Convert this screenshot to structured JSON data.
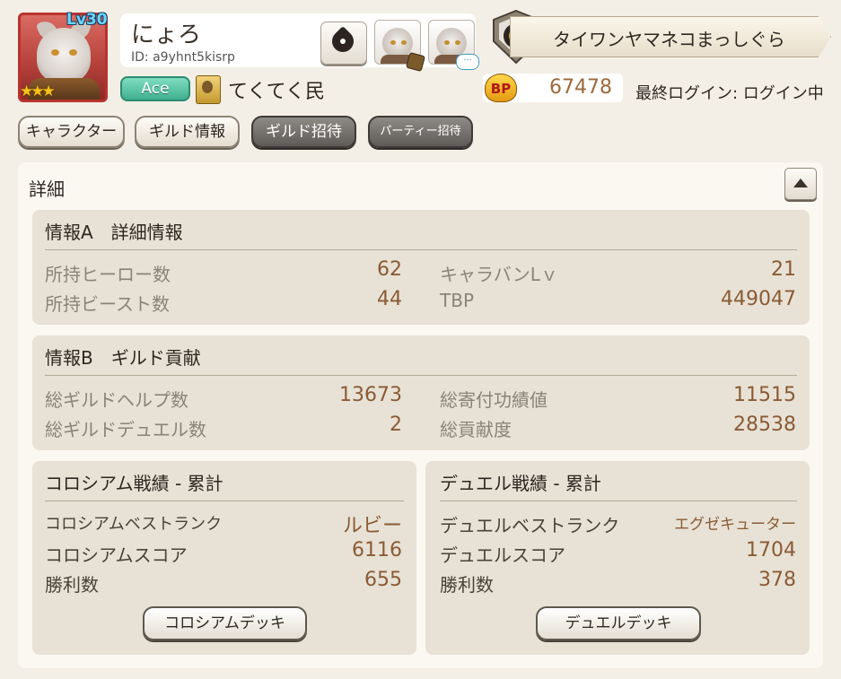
{
  "player": {
    "level": "Lv30",
    "name": "にょろ",
    "id": "ID: a9yhnt5kisrp",
    "rank": "Ace",
    "title": "てくてく民",
    "stars": "★★★"
  },
  "guild": {
    "name": "タイワンヤマネコまっしぐら"
  },
  "bp": {
    "label": "BP",
    "value": "67478"
  },
  "last_login": "最終ログイン: ログイン中",
  "tabs": [
    "キャラクター",
    "ギルド情報",
    "ギルド招待",
    "パーティー招待"
  ],
  "detail": {
    "title": "詳細",
    "info_a": {
      "title": "情報A　詳細情報",
      "rows": [
        {
          "label": "所持ヒーロー数",
          "value": "62"
        },
        {
          "label": "所持ビースト数",
          "value": "44"
        },
        {
          "label": "キャラバンLｖ",
          "value": "21"
        },
        {
          "label": "TBP",
          "value": "449047"
        }
      ]
    },
    "info_b": {
      "title": "情報B　ギルド貢献",
      "rows": [
        {
          "label": "総ギルドヘルプ数",
          "value": "13673"
        },
        {
          "label": "総ギルドデュエル数",
          "value": "2"
        },
        {
          "label": "総寄付功績値",
          "value": "11515"
        },
        {
          "label": "総貢献度",
          "value": "28538"
        }
      ]
    },
    "colosseum": {
      "title": "コロシアム戦績 - 累計",
      "rows": [
        {
          "label": "コロシアムベストランク",
          "value": "ルビー"
        },
        {
          "label": "コロシアムスコア",
          "value": "6116"
        },
        {
          "label": "勝利数",
          "value": "655"
        }
      ],
      "button": "コロシアムデッキ"
    },
    "duel": {
      "title": "デュエル戦績 - 累計",
      "rows": [
        {
          "label": "デュエルベストランク",
          "value": "エグゼキューター"
        },
        {
          "label": "デュエルスコア",
          "value": "1704"
        },
        {
          "label": "勝利数",
          "value": "378"
        }
      ],
      "button": "デュエルデッキ"
    }
  },
  "colors": {
    "value_brown": "#8b5a35",
    "ace_green": "#3fb08f",
    "avatar_red": "#b8332e"
  }
}
